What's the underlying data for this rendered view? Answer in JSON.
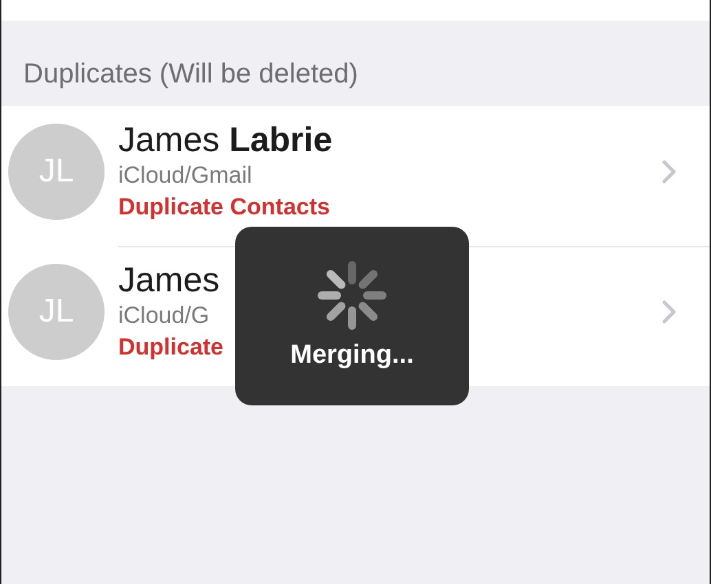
{
  "section_header": "Duplicates (Will be deleted)",
  "contacts": [
    {
      "initials": "JL",
      "name": "James **Labrie**",
      "account": "iCloud/Gmail",
      "tag": "Duplicate Contacts"
    },
    {
      "initials": "JL",
      "name": "James",
      "account": "iCloud/G",
      "tag": "Duplicate"
    }
  ],
  "progress_hud": {
    "label": "Merging..."
  }
}
